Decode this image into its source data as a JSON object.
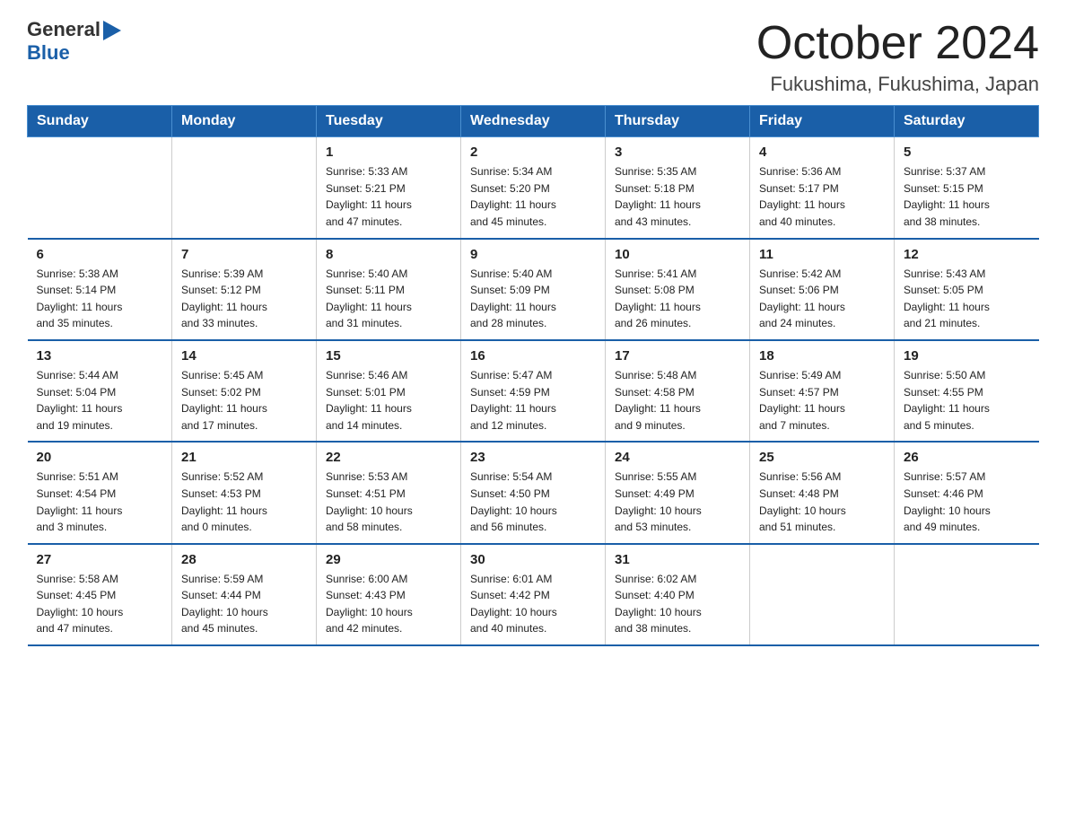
{
  "logo": {
    "general": "General",
    "blue": "Blue"
  },
  "title": "October 2024",
  "location": "Fukushima, Fukushima, Japan",
  "headers": [
    "Sunday",
    "Monday",
    "Tuesday",
    "Wednesday",
    "Thursday",
    "Friday",
    "Saturday"
  ],
  "weeks": [
    [
      {
        "day": "",
        "info": ""
      },
      {
        "day": "",
        "info": ""
      },
      {
        "day": "1",
        "info": "Sunrise: 5:33 AM\nSunset: 5:21 PM\nDaylight: 11 hours\nand 47 minutes."
      },
      {
        "day": "2",
        "info": "Sunrise: 5:34 AM\nSunset: 5:20 PM\nDaylight: 11 hours\nand 45 minutes."
      },
      {
        "day": "3",
        "info": "Sunrise: 5:35 AM\nSunset: 5:18 PM\nDaylight: 11 hours\nand 43 minutes."
      },
      {
        "day": "4",
        "info": "Sunrise: 5:36 AM\nSunset: 5:17 PM\nDaylight: 11 hours\nand 40 minutes."
      },
      {
        "day": "5",
        "info": "Sunrise: 5:37 AM\nSunset: 5:15 PM\nDaylight: 11 hours\nand 38 minutes."
      }
    ],
    [
      {
        "day": "6",
        "info": "Sunrise: 5:38 AM\nSunset: 5:14 PM\nDaylight: 11 hours\nand 35 minutes."
      },
      {
        "day": "7",
        "info": "Sunrise: 5:39 AM\nSunset: 5:12 PM\nDaylight: 11 hours\nand 33 minutes."
      },
      {
        "day": "8",
        "info": "Sunrise: 5:40 AM\nSunset: 5:11 PM\nDaylight: 11 hours\nand 31 minutes."
      },
      {
        "day": "9",
        "info": "Sunrise: 5:40 AM\nSunset: 5:09 PM\nDaylight: 11 hours\nand 28 minutes."
      },
      {
        "day": "10",
        "info": "Sunrise: 5:41 AM\nSunset: 5:08 PM\nDaylight: 11 hours\nand 26 minutes."
      },
      {
        "day": "11",
        "info": "Sunrise: 5:42 AM\nSunset: 5:06 PM\nDaylight: 11 hours\nand 24 minutes."
      },
      {
        "day": "12",
        "info": "Sunrise: 5:43 AM\nSunset: 5:05 PM\nDaylight: 11 hours\nand 21 minutes."
      }
    ],
    [
      {
        "day": "13",
        "info": "Sunrise: 5:44 AM\nSunset: 5:04 PM\nDaylight: 11 hours\nand 19 minutes."
      },
      {
        "day": "14",
        "info": "Sunrise: 5:45 AM\nSunset: 5:02 PM\nDaylight: 11 hours\nand 17 minutes."
      },
      {
        "day": "15",
        "info": "Sunrise: 5:46 AM\nSunset: 5:01 PM\nDaylight: 11 hours\nand 14 minutes."
      },
      {
        "day": "16",
        "info": "Sunrise: 5:47 AM\nSunset: 4:59 PM\nDaylight: 11 hours\nand 12 minutes."
      },
      {
        "day": "17",
        "info": "Sunrise: 5:48 AM\nSunset: 4:58 PM\nDaylight: 11 hours\nand 9 minutes."
      },
      {
        "day": "18",
        "info": "Sunrise: 5:49 AM\nSunset: 4:57 PM\nDaylight: 11 hours\nand 7 minutes."
      },
      {
        "day": "19",
        "info": "Sunrise: 5:50 AM\nSunset: 4:55 PM\nDaylight: 11 hours\nand 5 minutes."
      }
    ],
    [
      {
        "day": "20",
        "info": "Sunrise: 5:51 AM\nSunset: 4:54 PM\nDaylight: 11 hours\nand 3 minutes."
      },
      {
        "day": "21",
        "info": "Sunrise: 5:52 AM\nSunset: 4:53 PM\nDaylight: 11 hours\nand 0 minutes."
      },
      {
        "day": "22",
        "info": "Sunrise: 5:53 AM\nSunset: 4:51 PM\nDaylight: 10 hours\nand 58 minutes."
      },
      {
        "day": "23",
        "info": "Sunrise: 5:54 AM\nSunset: 4:50 PM\nDaylight: 10 hours\nand 56 minutes."
      },
      {
        "day": "24",
        "info": "Sunrise: 5:55 AM\nSunset: 4:49 PM\nDaylight: 10 hours\nand 53 minutes."
      },
      {
        "day": "25",
        "info": "Sunrise: 5:56 AM\nSunset: 4:48 PM\nDaylight: 10 hours\nand 51 minutes."
      },
      {
        "day": "26",
        "info": "Sunrise: 5:57 AM\nSunset: 4:46 PM\nDaylight: 10 hours\nand 49 minutes."
      }
    ],
    [
      {
        "day": "27",
        "info": "Sunrise: 5:58 AM\nSunset: 4:45 PM\nDaylight: 10 hours\nand 47 minutes."
      },
      {
        "day": "28",
        "info": "Sunrise: 5:59 AM\nSunset: 4:44 PM\nDaylight: 10 hours\nand 45 minutes."
      },
      {
        "day": "29",
        "info": "Sunrise: 6:00 AM\nSunset: 4:43 PM\nDaylight: 10 hours\nand 42 minutes."
      },
      {
        "day": "30",
        "info": "Sunrise: 6:01 AM\nSunset: 4:42 PM\nDaylight: 10 hours\nand 40 minutes."
      },
      {
        "day": "31",
        "info": "Sunrise: 6:02 AM\nSunset: 4:40 PM\nDaylight: 10 hours\nand 38 minutes."
      },
      {
        "day": "",
        "info": ""
      },
      {
        "day": "",
        "info": ""
      }
    ]
  ]
}
